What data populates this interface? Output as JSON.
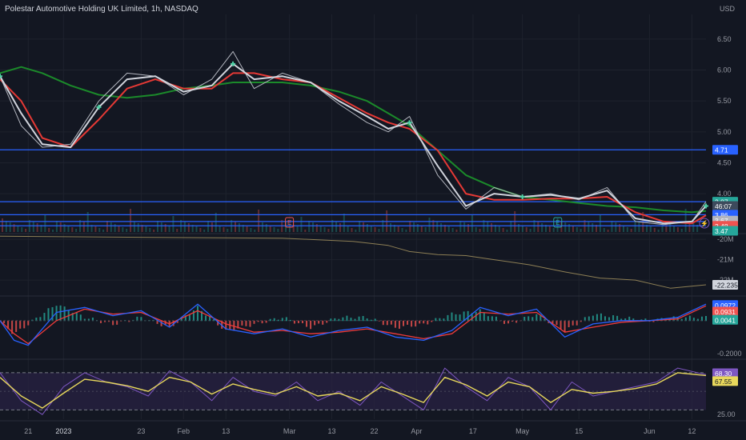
{
  "header": {
    "title": "Polestar Automotive Holding UK Limited, 1h, NASDAQ",
    "currency": "USD"
  },
  "colors": {
    "background": "#131722",
    "grid": "#1e222d",
    "price": "#b2b5be",
    "fast_ma": "#d1d4dc",
    "mid_ma": "#e53935",
    "slow_ma": "#1b8a2a",
    "hline": "#2962ff",
    "obv": "#8d7f55",
    "macd": "#2962ff",
    "signal": "#ef3b3b",
    "hist_up": "#26a69a",
    "hist_down": "#ef5350",
    "rsi": "#7e57c2",
    "rsi_ma": "#e8d85c",
    "rsi_band": "#2a2244"
  },
  "x_axis_labels": [
    "21",
    "2023",
    "23",
    "Feb",
    "13",
    "Mar",
    "13",
    "22",
    "Apr",
    "17",
    "May",
    "15",
    "Jun",
    "12"
  ],
  "markers": {
    "earnings": [
      "E",
      "E"
    ],
    "flash": "⚡"
  },
  "chart_data": [
    {
      "type": "line",
      "name": "price",
      "title": "Polestar Automotive Holding UK Limited, 1h, NASDAQ",
      "ylim": [
        3.38,
        6.9
      ],
      "ytick_labels": [
        "6.50",
        "6.00",
        "5.50",
        "5.00",
        "4.50",
        "4.00"
      ],
      "x": [
        0,
        3,
        6,
        10,
        14,
        18,
        22,
        26,
        30,
        33,
        36,
        40,
        44,
        48,
        52,
        55,
        58,
        62,
        66,
        70,
        74,
        78,
        82,
        86,
        90,
        94,
        98,
        100
      ],
      "close": [
        5.9,
        5.1,
        4.75,
        4.8,
        5.5,
        5.95,
        5.9,
        5.6,
        5.85,
        6.3,
        5.7,
        5.95,
        5.8,
        5.45,
        5.15,
        5.0,
        5.25,
        4.3,
        3.75,
        4.1,
        3.95,
        4.0,
        3.9,
        4.1,
        3.55,
        3.5,
        3.55,
        3.87
      ],
      "fast_ma": [
        5.9,
        5.3,
        4.8,
        4.75,
        5.4,
        5.85,
        5.9,
        5.65,
        5.75,
        6.1,
        5.85,
        5.9,
        5.8,
        5.5,
        5.25,
        5.05,
        5.15,
        4.45,
        3.8,
        4.0,
        3.95,
        3.98,
        3.92,
        4.05,
        3.6,
        3.52,
        3.55,
        3.8
      ],
      "mid_ma": [
        5.85,
        5.5,
        4.9,
        4.75,
        5.2,
        5.7,
        5.85,
        5.7,
        5.7,
        5.95,
        5.95,
        5.85,
        5.8,
        5.55,
        5.3,
        5.15,
        5.05,
        4.7,
        4.0,
        3.9,
        3.9,
        3.92,
        3.92,
        3.95,
        3.7,
        3.55,
        3.52,
        3.65
      ],
      "slow_ma": [
        5.95,
        6.05,
        5.95,
        5.75,
        5.6,
        5.55,
        5.6,
        5.7,
        5.75,
        5.8,
        5.8,
        5.8,
        5.75,
        5.65,
        5.5,
        5.3,
        5.1,
        4.7,
        4.3,
        4.1,
        3.95,
        3.9,
        3.85,
        3.8,
        3.78,
        3.73,
        3.7,
        3.72
      ],
      "horizontal_lines": [
        4.71,
        3.87,
        3.66,
        3.55,
        3.48
      ],
      "price_labels": [
        {
          "text": "4.71",
          "value": 4.71,
          "color": "#2962ff"
        },
        {
          "text": "3.87",
          "value": 3.87,
          "color": "#26a69a"
        },
        {
          "text": "46:07",
          "value": 3.8,
          "color": "#3d4a5c"
        },
        {
          "text": "3.86",
          "value": 3.66,
          "color": "#2962ff"
        },
        {
          "text": "3.67",
          "value": 3.565,
          "color": "#b2b5be"
        },
        {
          "text": "3.48",
          "value": 3.48,
          "color": "#ef5350"
        },
        {
          "text": "3.47",
          "value": 3.4,
          "color": "#26a69a"
        }
      ]
    },
    {
      "type": "line",
      "name": "obv",
      "ylim": [
        -22.7,
        -19.8
      ],
      "ytick_labels": [
        "-20M",
        "-21M",
        "-22M"
      ],
      "ytick_values": [
        -20,
        -21,
        -22
      ],
      "x": [
        0,
        20,
        40,
        50,
        55,
        58,
        62,
        66,
        70,
        75,
        80,
        85,
        90,
        95,
        100
      ],
      "values": [
        -19.85,
        -19.9,
        -19.95,
        -20.1,
        -20.3,
        -20.6,
        -20.75,
        -20.8,
        -21.0,
        -21.25,
        -21.6,
        -21.9,
        -22.0,
        -22.4,
        -22.23
      ],
      "last_label": "-22.235M"
    },
    {
      "type": "line",
      "name": "macd",
      "ylim": [
        -0.22,
        0.14
      ],
      "ytick_labels": [
        "-0.2000"
      ],
      "ytick_values": [
        -0.2
      ],
      "x": [
        0,
        2,
        4,
        8,
        12,
        16,
        20,
        24,
        28,
        32,
        36,
        40,
        44,
        48,
        52,
        56,
        60,
        64,
        68,
        72,
        76,
        80,
        84,
        88,
        92,
        96,
        100
      ],
      "macd": [
        0.0,
        -0.12,
        -0.15,
        0.05,
        0.08,
        0.03,
        0.06,
        -0.04,
        0.1,
        -0.05,
        -0.08,
        -0.05,
        -0.1,
        -0.06,
        -0.04,
        -0.1,
        -0.12,
        -0.06,
        0.08,
        0.03,
        0.07,
        -0.1,
        -0.02,
        0.0,
        0.0,
        0.02,
        0.1
      ],
      "signal": [
        0.0,
        -0.08,
        -0.14,
        0.0,
        0.07,
        0.04,
        0.05,
        -0.02,
        0.06,
        -0.02,
        -0.07,
        -0.06,
        -0.08,
        -0.07,
        -0.05,
        -0.08,
        -0.11,
        -0.08,
        0.05,
        0.04,
        0.05,
        -0.07,
        -0.04,
        -0.01,
        0.0,
        0.01,
        0.09
      ],
      "labels": [
        {
          "text": "0.0972",
          "value": 0.095,
          "color": "#2962ff"
        },
        {
          "text": "0.0931",
          "value": 0.055,
          "color": "#ef5350"
        },
        {
          "text": "0.0041",
          "value": 0.005,
          "color": "#26a69a"
        }
      ]
    },
    {
      "type": "line",
      "name": "rsi",
      "ylim": [
        20,
        82
      ],
      "ytick_labels": [
        "25.00"
      ],
      "ytick_values": [
        25
      ],
      "bands": [
        70,
        30
      ],
      "midline": 50,
      "x": [
        0,
        3,
        6,
        9,
        12,
        15,
        18,
        21,
        24,
        27,
        30,
        33,
        36,
        39,
        42,
        45,
        48,
        51,
        54,
        57,
        60,
        63,
        66,
        69,
        72,
        75,
        78,
        81,
        84,
        87,
        90,
        93,
        96,
        100
      ],
      "rsi": [
        70,
        40,
        25,
        55,
        70,
        60,
        55,
        45,
        72,
        60,
        40,
        65,
        50,
        45,
        60,
        40,
        50,
        35,
        60,
        45,
        30,
        75,
        55,
        40,
        65,
        55,
        30,
        60,
        45,
        50,
        55,
        60,
        75,
        68
      ],
      "rsi_ma": [
        65,
        45,
        32,
        48,
        63,
        60,
        56,
        50,
        65,
        60,
        47,
        58,
        52,
        47,
        55,
        45,
        48,
        40,
        55,
        47,
        38,
        65,
        57,
        45,
        60,
        55,
        38,
        52,
        48,
        50,
        53,
        58,
        70,
        67
      ],
      "labels": [
        {
          "text": "68.30",
          "value": 69.5,
          "color": "#7e57c2"
        },
        {
          "text": "67.55",
          "value": 61,
          "color": "#e8d85c"
        }
      ]
    }
  ]
}
